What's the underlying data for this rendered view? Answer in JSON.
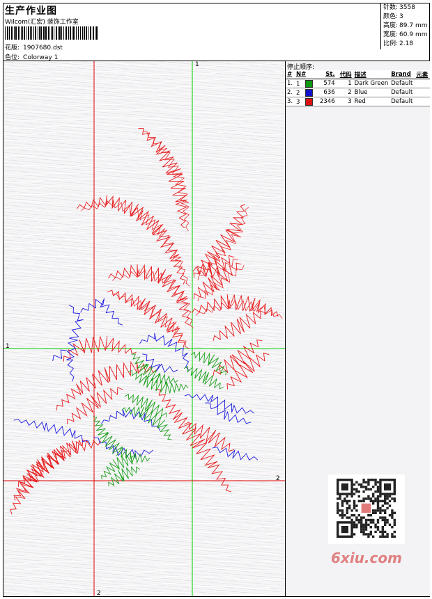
{
  "header": {
    "title": "生产作业图",
    "studio": "Wilcom(汇宏) 装饰工作室",
    "design_label": "花版:",
    "design_value": "1907680.dst",
    "colorway_label": "色位:",
    "colorway_value": "Colorway 1"
  },
  "stats": [
    {
      "label": "针数:",
      "value": "3558"
    },
    {
      "label": "颜色:",
      "value": "3"
    },
    {
      "label": "高度:",
      "value": "89.7 mm"
    },
    {
      "label": "宽度:",
      "value": "60.9 mm"
    },
    {
      "label": "比例:",
      "value": "2.18"
    }
  ],
  "stop_sequence": {
    "title": "停止顺序:",
    "columns": [
      "#",
      "N#",
      "St.",
      "代码",
      "描述",
      "Brand",
      "元素"
    ],
    "rows": [
      {
        "num": "1.",
        "n": "1",
        "color": "#119911",
        "st": "574",
        "code": "1",
        "desc": "Dark Green",
        "brand": "Default",
        "element": ""
      },
      {
        "num": "2.",
        "n": "2",
        "color": "#1111cc",
        "st": "636",
        "code": "2",
        "desc": "Blue",
        "brand": "Default",
        "element": ""
      },
      {
        "num": "3.",
        "n": "3",
        "color": "#dd1111",
        "st": "2346",
        "code": "3",
        "desc": "Red",
        "brand": "Default",
        "element": ""
      }
    ]
  },
  "axes": {
    "v1_top": "1",
    "h1_left": "1",
    "h2_right": "2",
    "v2_bottom": "2"
  },
  "watermark": "6xiu.com",
  "colors": {
    "red": "#e8191a",
    "blue": "#1a1ae0",
    "green": "#1aa01a",
    "axis_red": "#e00000",
    "axis_green": "#00d000"
  }
}
